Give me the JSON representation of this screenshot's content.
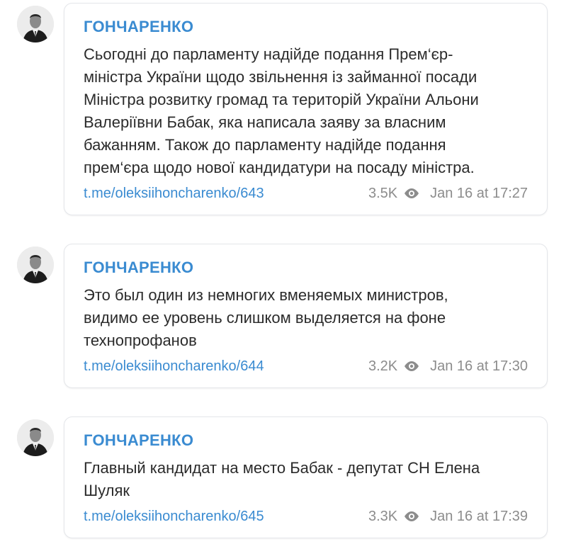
{
  "posts": [
    {
      "author": "ГОНЧАРЕНКО",
      "text": "Сьогодні до парламенту надійде подання Прем‘єр-\nміністра України щодо звільнення із займанної посади\nМіністра розвитку громад та територій України Альони\nВалеріївни Бабак, яка написала заяву за власним\nбажанням. Також до парламенту надійде подання\nпрем‘єра щодо нової кандидатури на посаду міністра.",
      "link": "t.me/oleksiihoncharenko/643",
      "views": "3.5K",
      "date": "Jan 16 at 17:27",
      "avatar_icon": "person-in-suit-avatar",
      "views_icon": "eye-icon"
    },
    {
      "author": "ГОНЧАРЕНКО",
      "text": "Это был один из немногих вменяемых министров,\nвидимо ее уровень слишком выделяется на фоне\nтехнопрофанов",
      "link": "t.me/oleksiihoncharenko/644",
      "views": "3.2K",
      "date": "Jan 16 at 17:30",
      "avatar_icon": "person-in-suit-avatar",
      "views_icon": "eye-icon"
    },
    {
      "author": "ГОНЧАРЕНКО",
      "text": "Главный кандидат на место Бабак - депутат СН Елена\nШуляк",
      "link": "t.me/oleksiihoncharenko/645",
      "views": "3.3K",
      "date": "Jan 16 at 17:39",
      "avatar_icon": "person-in-suit-avatar",
      "views_icon": "eye-icon"
    }
  ],
  "colors": {
    "accent": "#3a8bd1",
    "text": "#2b2b2b",
    "meta": "#8c8c8c",
    "border": "#e4e6ea"
  }
}
